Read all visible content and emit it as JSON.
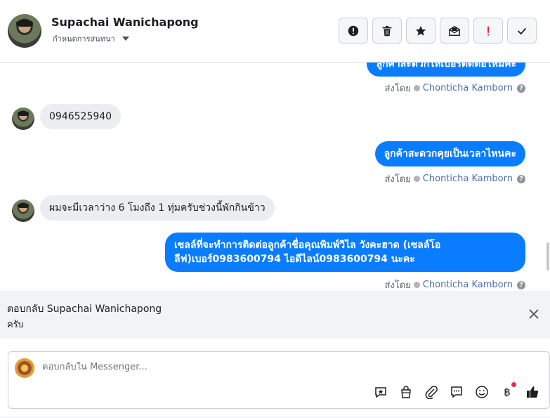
{
  "header": {
    "name": "Supachai Wanichapong",
    "subtitle": "กำหนดการสนทนา",
    "actions": [
      {
        "icon": "alert-circle-icon",
        "name": "spam-button"
      },
      {
        "icon": "trash-icon",
        "name": "delete-button"
      },
      {
        "icon": "star-icon",
        "name": "star-button"
      },
      {
        "icon": "mark-unread-icon",
        "name": "mark-unread-button"
      },
      {
        "icon": "priority-icon",
        "name": "follow-up-button"
      },
      {
        "icon": "check-icon",
        "name": "done-button"
      }
    ]
  },
  "messages": {
    "m1_text": "ลูกค้าสะดวกให้เบอร์ติดต่อไหมคะ",
    "m1_sentby_prefix": "ส่งโดย",
    "m1_agent": "Chonticha Kamborn",
    "m2_text": "0946525940",
    "m3_text": "ลูกค้าสะดวกคุยเป็นเวลาไหนคะ",
    "m3_sentby_prefix": "ส่งโดย",
    "m3_agent": "Chonticha Kamborn",
    "m4_text": "ผมจะมีเวลาว่าง 6 โมงถึง 1 ทุ่มครับช่วงนี้พักกินข้าว",
    "m5_line1": "เซลล์ที่จะทำการติดต่อลูกค้าชื่อคุณพิมพ์วิไล วังคะฮาด (เซลล์โอ",
    "m5_line2": "ลีฟ)เบอร์0983600794 ไอดีไลน์0983600794 นะคะ",
    "m5_sentby_prefix": "ส่งโดย",
    "m5_agent": "Chonticha Kamborn"
  },
  "reply": {
    "title": "ตอบกลับ Supachai Wanichapong",
    "text": "ครับ"
  },
  "composer": {
    "placeholder": "ตอบกลับใน Messenger..."
  },
  "colors": {
    "accent": "#0a7cff",
    "incoming_bg": "#ebedf0",
    "agent_link": "#4b6fa8"
  }
}
